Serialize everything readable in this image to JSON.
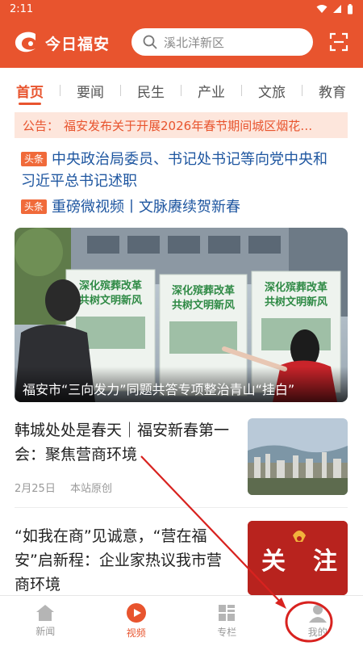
{
  "status_bar": {
    "time": "2:11"
  },
  "header": {
    "logo_text": "今日福安",
    "search_placeholder": "溪北洋新区"
  },
  "tabs": [
    {
      "label": "首页",
      "active": true
    },
    {
      "label": "要闻",
      "active": false
    },
    {
      "label": "民生",
      "active": false
    },
    {
      "label": "产业",
      "active": false
    },
    {
      "label": "文旅",
      "active": false
    },
    {
      "label": "教育",
      "active": false
    }
  ],
  "notice": {
    "label": "公告：",
    "text": "福安发布关于开展2026年春节期间城区烟花…"
  },
  "headlines": [
    {
      "badge": "头条",
      "text": "中央政治局委员、书记处书记等向党中央和习近平总书记述职"
    },
    {
      "badge": "头条",
      "text": "重磅微视频丨文脉赓续贺新春"
    }
  ],
  "feature": {
    "caption": "福安市“三向发力”同题共答专项整治青山“挂白”",
    "board_text": "深化殡葬改革共树文明新风"
  },
  "news": [
    {
      "title": "韩城处处是春天｜福安新春第一会：聚焦营商环境",
      "date": "2月25日",
      "source": "本站原创"
    },
    {
      "title": "“如我在商”见诚意，“营在福安”启新程：企业家热议我市营商环境",
      "thumb_text_1": "关",
      "thumb_text_2": "注"
    }
  ],
  "bottom_nav": [
    {
      "label": "新闻",
      "icon": "home-icon",
      "active": false
    },
    {
      "label": "视频",
      "icon": "play-icon",
      "active": true
    },
    {
      "label": "专栏",
      "icon": "grid-icon",
      "active": false
    },
    {
      "label": "我的",
      "icon": "user-icon",
      "active": false
    }
  ],
  "colors": {
    "brand": "#e8542e",
    "headline_blue": "#1e56a0",
    "notice_bg": "#fde6dc",
    "annotation_red": "#d8221f"
  }
}
